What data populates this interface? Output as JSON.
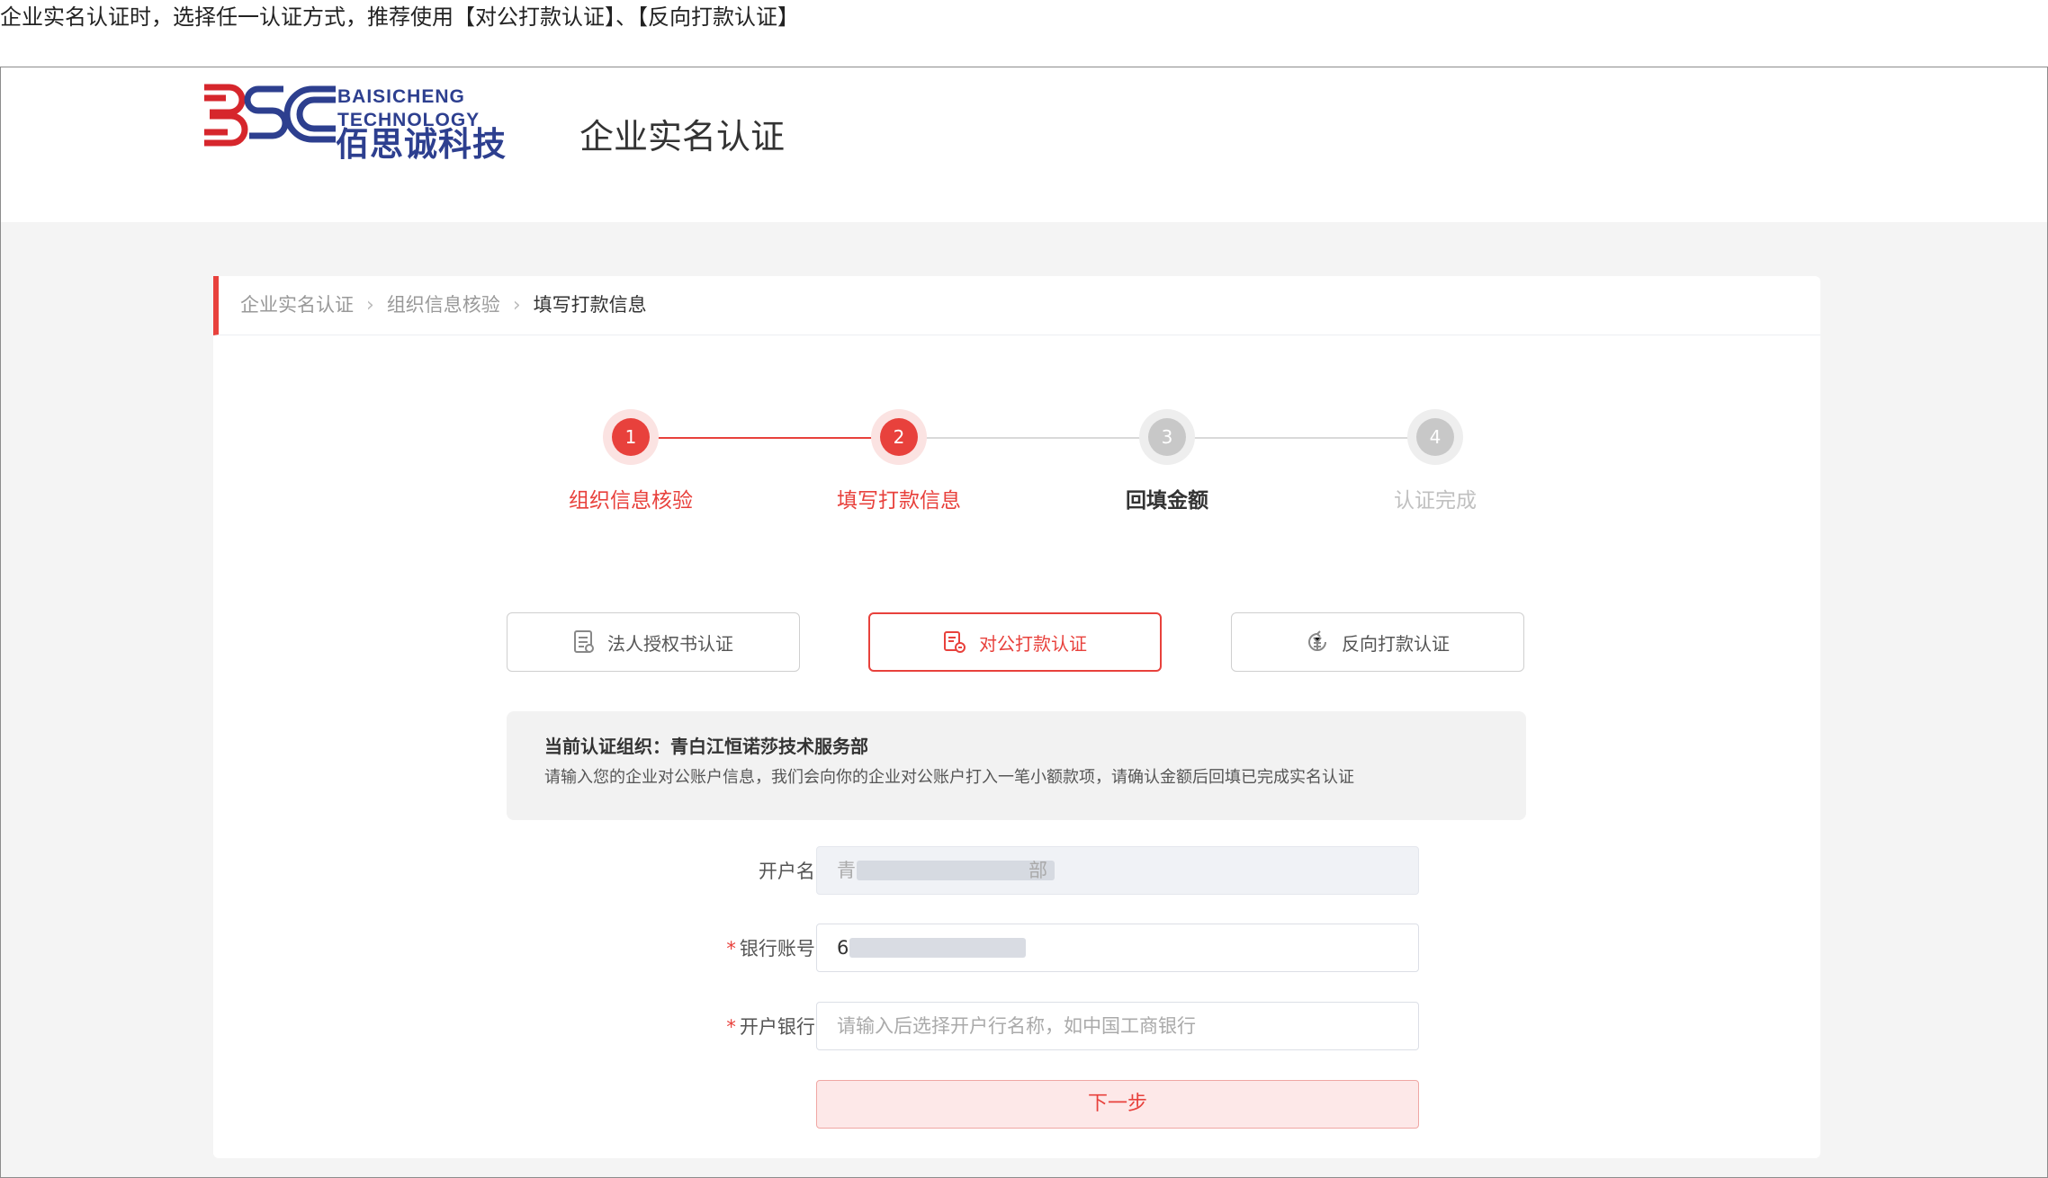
{
  "caption": "企业实名认证时，选择任一认证方式，推荐使用【对公打款认证】、【反向打款认证】",
  "header": {
    "logo_en_line1": "BAISICHENG",
    "logo_en_line2": "TECHNOLOGY",
    "logo_cn": "佰思诚科技",
    "title": "企业实名认证"
  },
  "breadcrumb": {
    "items": [
      "企业实名认证",
      "组织信息核验",
      "填写打款信息"
    ]
  },
  "steps": [
    {
      "number": "1",
      "label": "组织信息核验",
      "state": "done"
    },
    {
      "number": "2",
      "label": "填写打款信息",
      "state": "current"
    },
    {
      "number": "3",
      "label": "回填金额",
      "state": "next"
    },
    {
      "number": "4",
      "label": "认证完成",
      "state": "pending"
    }
  ],
  "methods": [
    {
      "label": "法人授权书认证",
      "icon": "document-icon",
      "active": false
    },
    {
      "label": "对公打款认证",
      "icon": "bank-transfer-icon",
      "active": true
    },
    {
      "label": "反向打款认证",
      "icon": "yuan-refund-icon",
      "active": false
    }
  ],
  "info": {
    "title": "当前认证组织：青白江恒诺莎技术服务部",
    "desc": "请输入您的企业对公账户信息，我们会向你的企业对公账户打入一笔小额款项，请确认金额后回填已完成实名认证"
  },
  "form": {
    "account_name_label": "开户名:",
    "account_name_prefix": "青",
    "account_name_suffix": "部",
    "bank_account_label": "银行账号:",
    "bank_account_prefix": "6",
    "bank_label": "开户银行:",
    "bank_placeholder": "请输入后选择开户行名称，如中国工商银行",
    "required_mark": "*",
    "next_label": "下一步"
  },
  "colors": {
    "accent": "#e8413c",
    "brand": "#2d3f8f",
    "brand_red": "#d6262c"
  }
}
